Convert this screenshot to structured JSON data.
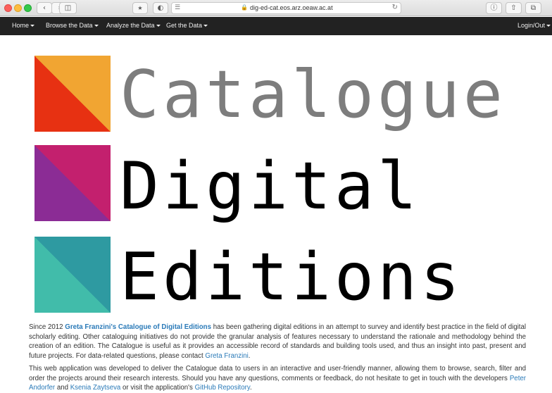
{
  "browser": {
    "url": "dig-ed-cat.eos.arz.oeaw.ac.at",
    "back_icon": "chevron-left",
    "forward_icon": "chevron-right"
  },
  "navbar": {
    "home": "Home",
    "browse": "Browse the Data",
    "analyze": "Analyze the Data",
    "get": "Get the Data",
    "login": "Login/Out"
  },
  "logo": {
    "word1": "Catalogue",
    "word2": "Digital",
    "word3": "Editions",
    "colors": {
      "square1": [
        "#e73112",
        "#f1a532"
      ],
      "square2": [
        "#8b2c95",
        "#c3206e"
      ],
      "square3": [
        "#41bcaa",
        "#2e9aa1"
      ]
    }
  },
  "intro": {
    "p1_a": "Since 2012 ",
    "p1_link": "Greta Franzini's Catalogue of Digital Editions",
    "p1_b": " has been gathering digital editions in an attempt to survey and identify best practice in the field of digital scholarly editing. Other cataloguing initiatives do not provide the granular analysis of features necessary to understand the rationale and methodology behind the creation of an edition. The Catalogue is useful as it provides an accessible record of standards and building tools used, and thus an insight into past, present and future projects. For data-related questions, please contact ",
    "p1_contact": "Greta Franzini",
    "p1_c": ".",
    "p2_a": "This web application was developed to deliver the Catalogue data to users in an interactive and user-friendly manner, allowing them to browse, search, filter and order the projects around their research interests. Should you have any questions, comments or feedback, do not hesitate to get in touch with the developers ",
    "p2_dev1": "Peter Andorfer",
    "p2_and": " and ",
    "p2_dev2": "Ksenia Zaytseva",
    "p2_b": " or visit the application's ",
    "p2_repo": "GitHub Repository",
    "p2_c": "."
  }
}
